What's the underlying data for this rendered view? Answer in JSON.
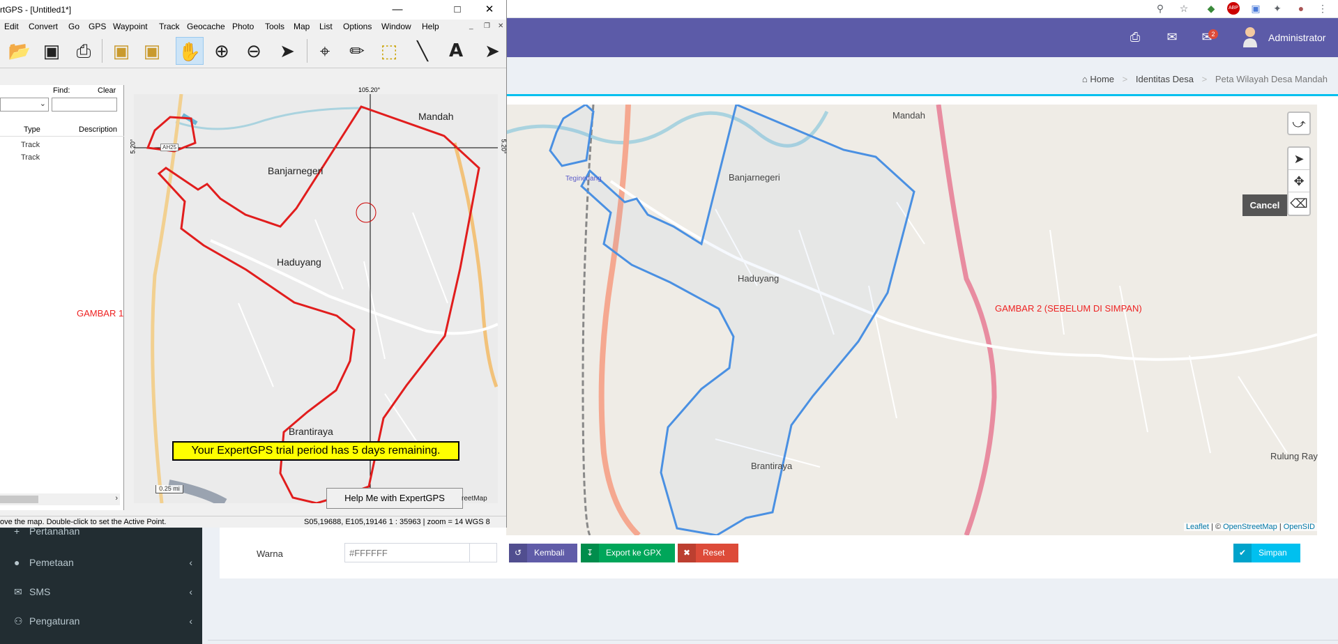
{
  "browser": {
    "toolbar_icons": [
      "zoom-icon",
      "star-icon",
      "extension-icon",
      "adblock-icon",
      "translate-icon",
      "puzzle-icon",
      "profile-icon",
      "menu-icon"
    ],
    "adblock_label": "ABP"
  },
  "header": {
    "mail_count": "2",
    "user_name": "Administrator"
  },
  "breadcrumb": {
    "home": "Home",
    "section": "Identitas Desa",
    "current": "Peta Wilayah Desa Mandah"
  },
  "map2": {
    "places": {
      "mandah": "Mandah",
      "banjarnegeri": "Banjarnegeri",
      "teginenang": "Teginenang",
      "haduyang": "Haduyang",
      "brantiraya": "Brantiraya",
      "rulung": "Rulung Ray"
    },
    "annotation": "GAMBAR 2 (SEBELUM DI SIMPAN)",
    "attribution": {
      "leaflet": "Leaflet",
      "sep": " | © ",
      "osm": "OpenStreetMap",
      "sep2": " | ",
      "opensid": "OpenSID"
    },
    "cancel_label": "Cancel",
    "polygon_color": "#4a90e2"
  },
  "form": {
    "warna_label": "Warna",
    "warna_placeholder": "#FFFFFF",
    "btn_kembali": "Kembali",
    "btn_export": "Export ke GPX",
    "btn_reset": "Reset",
    "btn_simpan": "Simpan"
  },
  "sidebar": {
    "items": [
      {
        "label": "Pertanahan",
        "icon": "plus-icon"
      },
      {
        "label": "Pemetaan",
        "icon": "globe-icon"
      },
      {
        "label": "SMS",
        "icon": "envelope-icon"
      },
      {
        "label": "Pengaturan",
        "icon": "users-icon"
      }
    ]
  },
  "gps": {
    "title": "rtGPS - [Untitled1*]",
    "menu": [
      "Edit",
      "Convert",
      "Go",
      "GPS",
      "Waypoint",
      "Track",
      "Geocache",
      "Photo",
      "Tools",
      "Map",
      "List",
      "Options",
      "Window",
      "Help"
    ],
    "find_label": "Find:",
    "clear_label": "Clear",
    "columns": {
      "type": "Type",
      "description": "Description"
    },
    "rows": [
      {
        "type": "Track"
      },
      {
        "type": "Track"
      }
    ],
    "annotation": "GAMBAR 1",
    "places": {
      "mandah": "Mandah",
      "banjarnegeri": "Banjarnegeri",
      "haduyang": "Haduyang",
      "brantiraya": "Brantiraya"
    },
    "road_labels": {
      "ah25": "AH25"
    },
    "coord_top": "105.20°",
    "coord_side": "5.20°",
    "trial_banner": "Your ExpertGPS trial period has 5 days remaining.",
    "help_button": "Help Me with ExpertGPS",
    "scale": "0.25 mi",
    "osm_attrib": "reetMap",
    "status_left": "ove the map.  Double-click to set the Active Point.",
    "status_right": "S05,19688, E105,19146   1 : 35963 | zoom = 14   WGS 8",
    "polygon_color": "#e11d1d"
  }
}
